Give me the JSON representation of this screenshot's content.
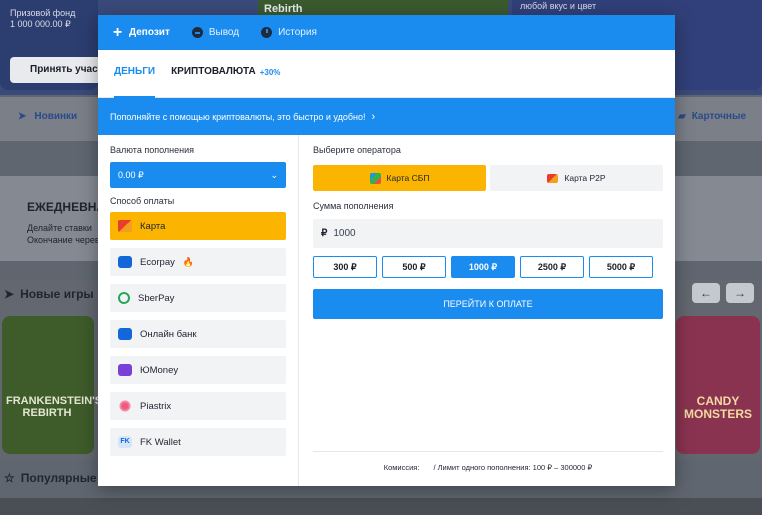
{
  "background": {
    "promo_fund_label": "Призовой фонд",
    "promo_fund_value": "1 000 000.00 ₽",
    "promo_button": "Принять участ",
    "promo2_title": "Rebirth",
    "promo3_text": "любой вкус и цвет",
    "nav_left": "Новинки",
    "nav_right": "Карточные",
    "weekly_title": "ЕЖЕДНЕВНА",
    "weekly_desc_1": "Делайте ставки",
    "weekly_desc_2": "Окончание черев",
    "new_games": "Новые игры",
    "popular": "Популярные",
    "game_left": "FRANKENSTEIN'S REBIRTH",
    "game_right": "CANDY MONSTERS",
    "arrow_prev": "←",
    "arrow_next": "→"
  },
  "modal": {
    "tabs": [
      {
        "label": "Депозит"
      },
      {
        "label": "Вывод"
      },
      {
        "label": "История"
      }
    ],
    "sub_tabs": {
      "money": "ДЕНЬГИ",
      "crypto": "КРИПТОВАЛЮТА",
      "crypto_badge": "+30%"
    },
    "banner": "Пополняйте с помощью криптовалюты, это быстро и удобно!",
    "currency_label": "Валюта пополнения",
    "currency_value": "0.00 ₽",
    "payment_method_label": "Способ оплаты",
    "payment_methods": [
      {
        "label": "Карта"
      },
      {
        "label": "Ecorpay"
      },
      {
        "label": "SberPay"
      },
      {
        "label": "Онлайн банк"
      },
      {
        "label": "ЮMoney"
      },
      {
        "label": "Piastrix"
      },
      {
        "label": "FK Wallet"
      }
    ],
    "operator_label": "Выберите оператора",
    "operators": [
      {
        "label": "Карта СБП"
      },
      {
        "label": "Карта P2P"
      }
    ],
    "amount_label": "Сумма пополнения",
    "amount_value": "1000",
    "presets": [
      "300 ₽",
      "500 ₽",
      "1000 ₽",
      "2500 ₽",
      "5000 ₽"
    ],
    "pay_button": "ПЕРЕЙТИ К ОПЛАТЕ",
    "commission_label": "Комиссия:",
    "limit_text": "/ Лимит одного пополнения: 100 ₽ – 300000 ₽"
  }
}
